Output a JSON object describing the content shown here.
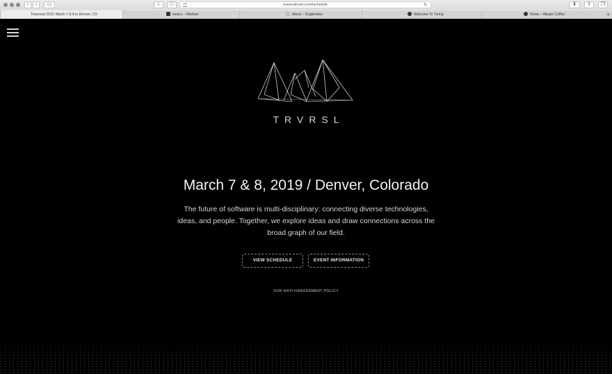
{
  "browser": {
    "url": "traversalconf.com/#schedule",
    "tabs": [
      {
        "label": "Traversal 2019: March 7 & 8 in Denver, CO",
        "active": true,
        "favicon": "none"
      },
      {
        "label": "basics – Medium",
        "active": false,
        "favicon": "medium-icon"
      },
      {
        "label": "About – Dogtimates",
        "active": false,
        "favicon": "image-icon"
      },
      {
        "label": "Welcome To Turing",
        "active": false,
        "favicon": "turing-icon"
      },
      {
        "label": "Home – Allegro Coffee",
        "active": false,
        "favicon": "allegro-icon"
      }
    ]
  },
  "site": {
    "wordmark": "TRVRSL",
    "headline": "March 7 & 8, 2019 / Denver, Colorado",
    "description": "The future of software is multi-disciplinary: connecting diverse technologies, ideas, and people. Together, we explore ideas and draw connections across the broad graph of our field.",
    "buttons": {
      "schedule": "VIEW SCHEDULE",
      "info": "EVENT INFORMATION"
    },
    "policy_link": "OUR ANTI-HARASSMENT POLICY"
  },
  "icons": {
    "menu": "hamburger-menu-icon",
    "logo": "mountain-peaks-logo"
  },
  "colors": {
    "background": "#000000",
    "text": "#f2f2f2",
    "muted": "#8a8a8a"
  }
}
